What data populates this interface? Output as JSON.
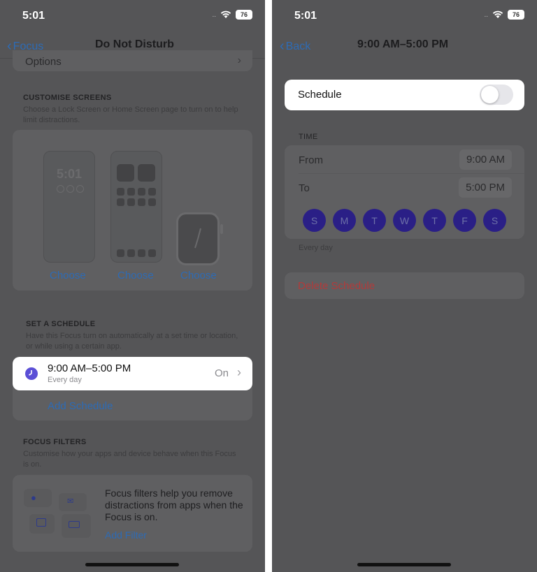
{
  "left": {
    "status_time": "5:01",
    "battery": "76",
    "nav": {
      "back": "Focus",
      "title": "Do Not Disturb"
    },
    "options_label": "Options",
    "customise": {
      "header": "CUSTOMISE SCREENS",
      "subtitle": "Choose a Lock Screen or Home Screen page to turn on to help limit distractions.",
      "lock_clock": "5:01",
      "choose_labels": [
        "Choose",
        "Choose",
        "Choose"
      ]
    },
    "schedule": {
      "header": "SET A SCHEDULE",
      "subtitle": "Have this Focus turn on automatically at a set time or location, or while using a certain app.",
      "item_time": "9:00 AM–5:00 PM",
      "item_sub": "Every day",
      "item_status": "On",
      "add_label": "Add Schedule"
    },
    "filters": {
      "header": "FOCUS FILTERS",
      "subtitle": "Customise how your apps and device behave when this Focus is on.",
      "body": "Focus filters help you remove distractions from apps when the Focus is on.",
      "add_label": "Add Filter"
    }
  },
  "right": {
    "status_time": "5:01",
    "battery": "76",
    "nav": {
      "back": "Back",
      "title": "9:00 AM–5:00 PM"
    },
    "schedule_label": "Schedule",
    "schedule_enabled": false,
    "time_header": "TIME",
    "from_label": "From",
    "from_value": "9:00 AM",
    "to_label": "To",
    "to_value": "5:00 PM",
    "days": [
      "S",
      "M",
      "T",
      "W",
      "T",
      "F",
      "S"
    ],
    "repeat_note": "Every day",
    "delete_label": "Delete Schedule"
  },
  "colors": {
    "accent_blue": "#2d6bb5",
    "destructive_red": "#b33a3a",
    "day_circle": "#2a1f86",
    "dim_overlay": "#555557"
  }
}
